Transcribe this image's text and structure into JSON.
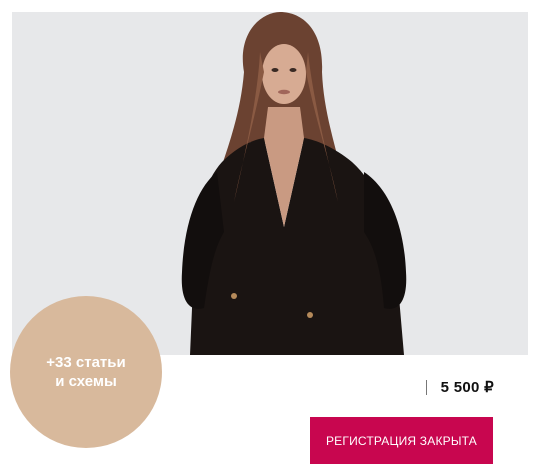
{
  "hero": {
    "image_alt": "model-photo"
  },
  "promo": {
    "line1": "+33 статьи",
    "line2": "и схемы"
  },
  "price": {
    "value": "5 500 ₽"
  },
  "action": {
    "register_label": "РЕГИСТРАЦИЯ ЗАКРЫТА"
  },
  "colors": {
    "hero_background": "#e7e8ea",
    "promo_circle": "#d8b99c",
    "button": "#c8064f"
  }
}
